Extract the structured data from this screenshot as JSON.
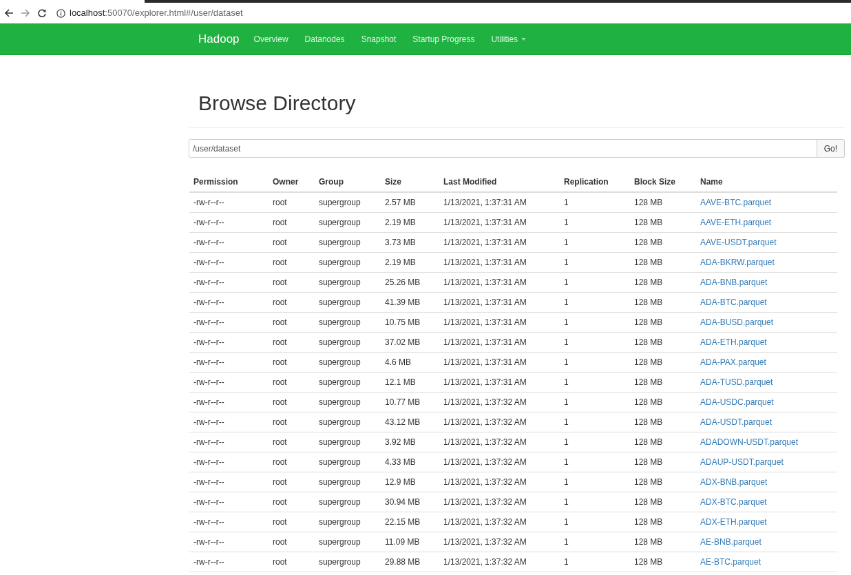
{
  "browser": {
    "url_host": "localhost",
    "url_rest": ":50070/explorer.html#/user/dataset"
  },
  "navbar": {
    "brand": "Hadoop",
    "items": [
      {
        "label": "Overview",
        "dropdown": false
      },
      {
        "label": "Datanodes",
        "dropdown": false
      },
      {
        "label": "Snapshot",
        "dropdown": false
      },
      {
        "label": "Startup Progress",
        "dropdown": false
      },
      {
        "label": "Utilities",
        "dropdown": true
      }
    ]
  },
  "title": "Browse Directory",
  "path_field": {
    "value": "/user/dataset"
  },
  "go_button": "Go!",
  "table": {
    "columns": [
      "Permission",
      "Owner",
      "Group",
      "Size",
      "Last Modified",
      "Replication",
      "Block Size",
      "Name"
    ],
    "rows": [
      [
        "-rw-r--r--",
        "root",
        "supergroup",
        "2.57 MB",
        "1/13/2021, 1:37:31 AM",
        "1",
        "128 MB",
        "AAVE-BTC.parquet"
      ],
      [
        "-rw-r--r--",
        "root",
        "supergroup",
        "2.19 MB",
        "1/13/2021, 1:37:31 AM",
        "1",
        "128 MB",
        "AAVE-ETH.parquet"
      ],
      [
        "-rw-r--r--",
        "root",
        "supergroup",
        "3.73 MB",
        "1/13/2021, 1:37:31 AM",
        "1",
        "128 MB",
        "AAVE-USDT.parquet"
      ],
      [
        "-rw-r--r--",
        "root",
        "supergroup",
        "2.19 MB",
        "1/13/2021, 1:37:31 AM",
        "1",
        "128 MB",
        "ADA-BKRW.parquet"
      ],
      [
        "-rw-r--r--",
        "root",
        "supergroup",
        "25.26 MB",
        "1/13/2021, 1:37:31 AM",
        "1",
        "128 MB",
        "ADA-BNB.parquet"
      ],
      [
        "-rw-r--r--",
        "root",
        "supergroup",
        "41.39 MB",
        "1/13/2021, 1:37:31 AM",
        "1",
        "128 MB",
        "ADA-BTC.parquet"
      ],
      [
        "-rw-r--r--",
        "root",
        "supergroup",
        "10.75 MB",
        "1/13/2021, 1:37:31 AM",
        "1",
        "128 MB",
        "ADA-BUSD.parquet"
      ],
      [
        "-rw-r--r--",
        "root",
        "supergroup",
        "37.02 MB",
        "1/13/2021, 1:37:31 AM",
        "1",
        "128 MB",
        "ADA-ETH.parquet"
      ],
      [
        "-rw-r--r--",
        "root",
        "supergroup",
        "4.6 MB",
        "1/13/2021, 1:37:31 AM",
        "1",
        "128 MB",
        "ADA-PAX.parquet"
      ],
      [
        "-rw-r--r--",
        "root",
        "supergroup",
        "12.1 MB",
        "1/13/2021, 1:37:31 AM",
        "1",
        "128 MB",
        "ADA-TUSD.parquet"
      ],
      [
        "-rw-r--r--",
        "root",
        "supergroup",
        "10.77 MB",
        "1/13/2021, 1:37:32 AM",
        "1",
        "128 MB",
        "ADA-USDC.parquet"
      ],
      [
        "-rw-r--r--",
        "root",
        "supergroup",
        "43.12 MB",
        "1/13/2021, 1:37:32 AM",
        "1",
        "128 MB",
        "ADA-USDT.parquet"
      ],
      [
        "-rw-r--r--",
        "root",
        "supergroup",
        "3.92 MB",
        "1/13/2021, 1:37:32 AM",
        "1",
        "128 MB",
        "ADADOWN-USDT.parquet"
      ],
      [
        "-rw-r--r--",
        "root",
        "supergroup",
        "4.33 MB",
        "1/13/2021, 1:37:32 AM",
        "1",
        "128 MB",
        "ADAUP-USDT.parquet"
      ],
      [
        "-rw-r--r--",
        "root",
        "supergroup",
        "12.9 MB",
        "1/13/2021, 1:37:32 AM",
        "1",
        "128 MB",
        "ADX-BNB.parquet"
      ],
      [
        "-rw-r--r--",
        "root",
        "supergroup",
        "30.94 MB",
        "1/13/2021, 1:37:32 AM",
        "1",
        "128 MB",
        "ADX-BTC.parquet"
      ],
      [
        "-rw-r--r--",
        "root",
        "supergroup",
        "22.15 MB",
        "1/13/2021, 1:37:32 AM",
        "1",
        "128 MB",
        "ADX-ETH.parquet"
      ],
      [
        "-rw-r--r--",
        "root",
        "supergroup",
        "11.09 MB",
        "1/13/2021, 1:37:32 AM",
        "1",
        "128 MB",
        "AE-BNB.parquet"
      ],
      [
        "-rw-r--r--",
        "root",
        "supergroup",
        "29.88 MB",
        "1/13/2021, 1:37:32 AM",
        "1",
        "128 MB",
        "AE-BTC.parquet"
      ]
    ]
  }
}
